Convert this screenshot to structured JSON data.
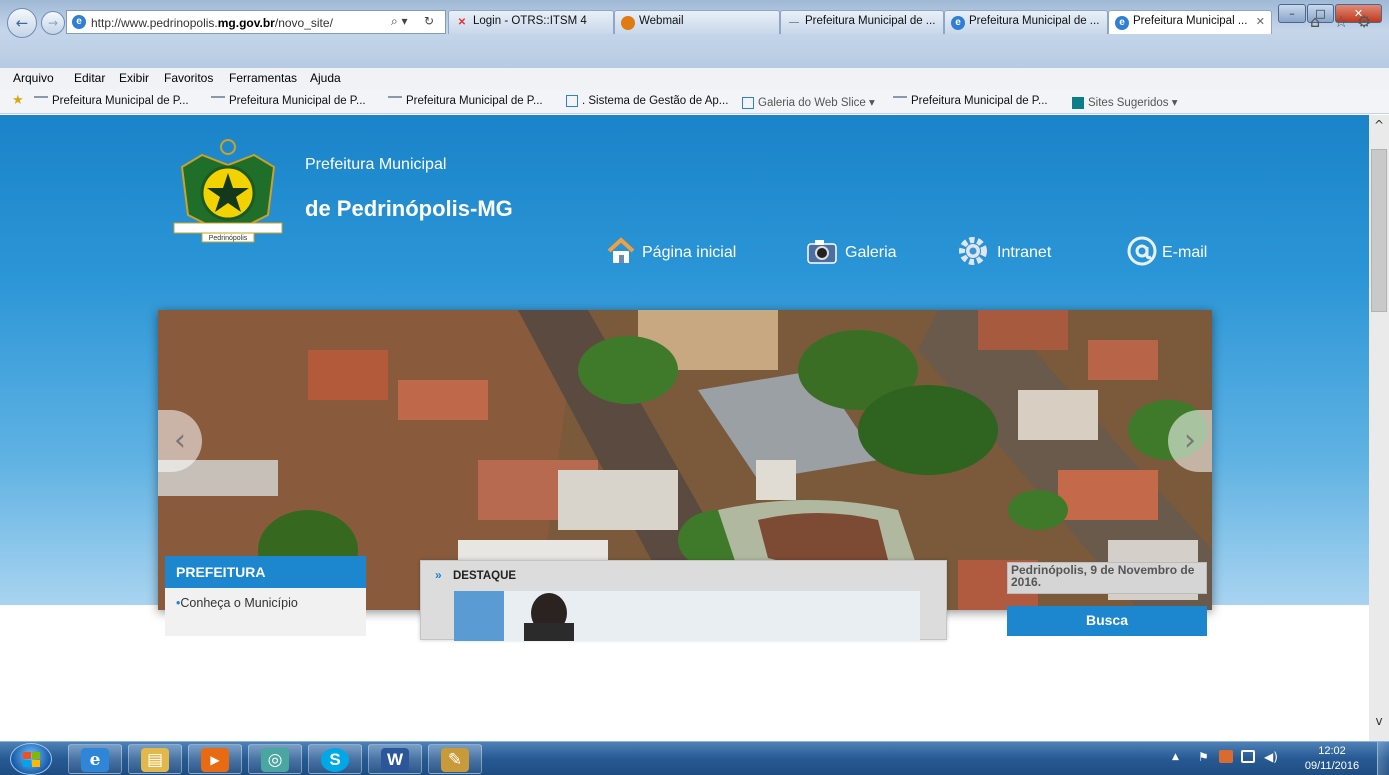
{
  "browser": {
    "address": {
      "url_prefix": "http://www.pedrinopolis.",
      "url_domain": "mg.gov.br",
      "url_suffix": "/novo_site/",
      "search_glyph": "⌕ ▾",
      "refresh_glyph": "↻"
    },
    "nav": {
      "back_glyph": "←",
      "forward_glyph": "→"
    },
    "caption": {
      "minimize": "–",
      "maximize": "□",
      "close": "✕"
    },
    "tabs": [
      {
        "label": "Login - OTRS::ITSM 4",
        "icon_color": "#e2302a",
        "icon_glyph": "✕"
      },
      {
        "label": "Webmail",
        "icon_color": "#e07a12",
        "icon_glyph": "●"
      },
      {
        "label": "Prefeitura Municipal de ...",
        "icon_color": "#7f8c99",
        "icon_glyph": "—"
      },
      {
        "label": "Prefeitura Municipal de ...",
        "icon_color": "#2f7fd3",
        "icon_glyph": "e"
      },
      {
        "label": "Prefeitura Municipal ...",
        "icon_color": "#2f7fd3",
        "icon_glyph": "e",
        "close": "✕"
      }
    ],
    "toolbar_icons": {
      "home": "⌂",
      "favorites": "☆",
      "tools": "⚙"
    },
    "menu": [
      "Arquivo",
      "Editar",
      "Exibir",
      "Favoritos",
      "Ferramentas",
      "Ajuda"
    ],
    "favorites_bar": {
      "star_glyph": "★",
      "links": [
        "Prefeitura Municipal de P...",
        "Prefeitura Municipal de P...",
        "Prefeitura Municipal de P...",
        ". Sistema de Gestão de Ap...",
        "Galeria do Web Slice ▾",
        "Prefeitura Municipal de P...",
        "Sites Sugeridos ▾"
      ]
    }
  },
  "site": {
    "title_line1": "Prefeitura Municipal",
    "title_line2": "de Pedrinópolis-MG",
    "crest_text": "Pedrinópolis",
    "nav": [
      {
        "label": "Página inicial",
        "icon": "home-icon"
      },
      {
        "label": "Galeria",
        "icon": "camera-icon"
      },
      {
        "label": "Intranet",
        "icon": "gear-icon"
      },
      {
        "label": "E-mail",
        "icon": "at-sign-icon"
      }
    ],
    "slider": {
      "prev_glyph": "‹",
      "next_glyph": "›"
    },
    "sidebar": {
      "header": "PREFEITURA",
      "items": [
        "Conheça o Município"
      ]
    },
    "destaque": {
      "arrows": "»",
      "label": "DESTAQUE"
    },
    "date": "Pedrinópolis, 9 de Novembro de 2016.",
    "busca": "Busca"
  },
  "scrollbar": {
    "up_glyph": "^",
    "down_glyph": "v"
  },
  "taskbar": {
    "apps": [
      {
        "name": "internet-explorer",
        "glyph": "e",
        "color": "#2f86d8"
      },
      {
        "name": "file-explorer",
        "glyph": "▤",
        "color": "#e2b84a"
      },
      {
        "name": "media-player",
        "glyph": "▶",
        "color": "#e86b14"
      },
      {
        "name": "network-app",
        "glyph": "◎",
        "color": "#4aa6a0"
      },
      {
        "name": "skype",
        "glyph": "S",
        "color": "#00a8e8"
      },
      {
        "name": "word",
        "glyph": "W",
        "color": "#2b579a"
      },
      {
        "name": "paint",
        "glyph": "✎",
        "color": "#c89a3a"
      }
    ],
    "tray": {
      "up_glyph": "▲",
      "flag_glyph": "⚑",
      "volume_glyph": "◀)"
    },
    "clock_time": "12:02",
    "clock_date": "09/11/2016"
  }
}
